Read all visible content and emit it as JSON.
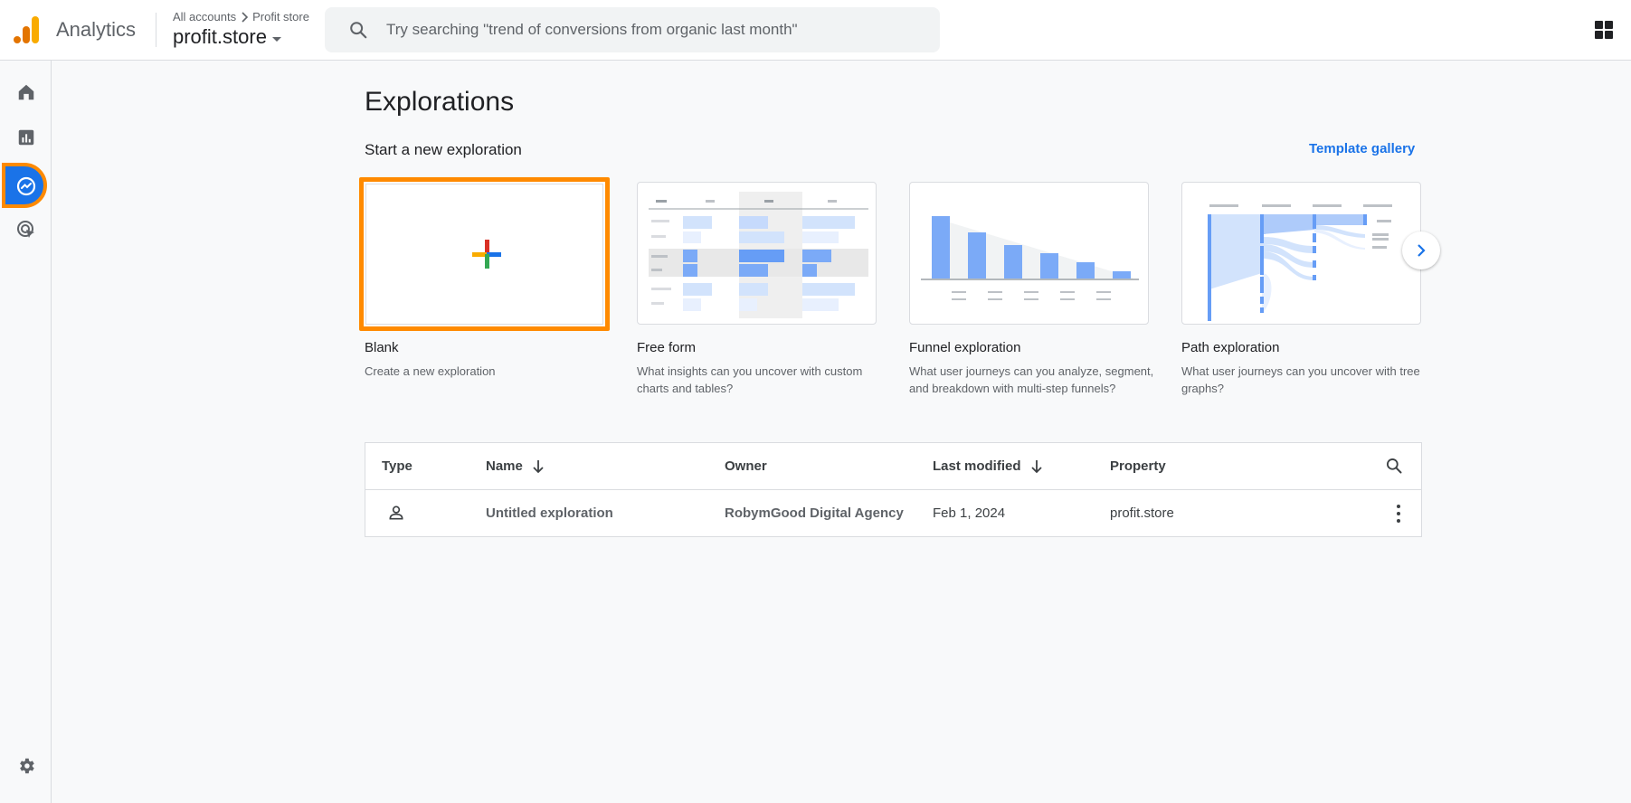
{
  "header": {
    "app_name": "Analytics",
    "breadcrumb": {
      "account": "All accounts",
      "property": "Profit store"
    },
    "property_selector": "profit.store",
    "search_placeholder": "Try searching \"trend of conversions from organic last month\""
  },
  "rail": {
    "items": [
      {
        "name": "home-icon",
        "active": false
      },
      {
        "name": "reports-icon",
        "active": false
      },
      {
        "name": "explore-icon",
        "active": true
      },
      {
        "name": "advertising-icon",
        "active": false
      }
    ],
    "settings": "gear-icon"
  },
  "main": {
    "title": "Explorations",
    "section_label": "Start a new exploration",
    "template_link": "Template gallery",
    "cards": [
      {
        "title": "Blank",
        "description": "Create a new exploration"
      },
      {
        "title": "Free form",
        "description": "What insights can you uncover with custom charts and tables?"
      },
      {
        "title": "Funnel exploration",
        "description": "What user journeys can you analyze, segment, and breakdown with multi-step funnels?"
      },
      {
        "title": "Path exploration",
        "description": "What user journeys can you uncover with tree graphs?"
      }
    ]
  },
  "table": {
    "columns": [
      "Type",
      "Name",
      "Owner",
      "Last modified",
      "Property"
    ],
    "rows": [
      {
        "type_icon": "person-icon",
        "name": "Untitled exploration",
        "owner": "RobymGood Digital Agency",
        "last_modified": "Feb 1, 2024",
        "property": "profit.store"
      }
    ]
  },
  "colors": {
    "accent": "#1a73e8",
    "highlight": "#ff8a00"
  }
}
